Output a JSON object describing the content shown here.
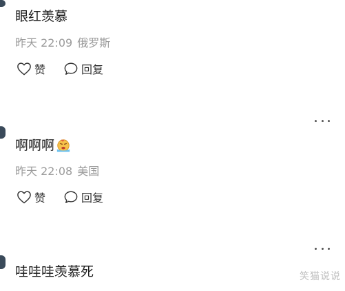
{
  "comments": [
    {
      "text": "眼红羡慕",
      "time": "昨天 22:09",
      "location": "俄罗斯",
      "like_label": "赞",
      "reply_label": "回复"
    },
    {
      "text": "啊啊啊",
      "emoji": "crying-face-emoji",
      "time": "昨天 22:08",
      "location": "美国",
      "like_label": "赞",
      "reply_label": "回复"
    },
    {
      "text": "哇哇哇羡慕死"
    }
  ],
  "watermark": "笑猫说说",
  "colors": {
    "text": "#1c1c1c",
    "meta": "#9a9a9a",
    "icon": "#333333"
  }
}
